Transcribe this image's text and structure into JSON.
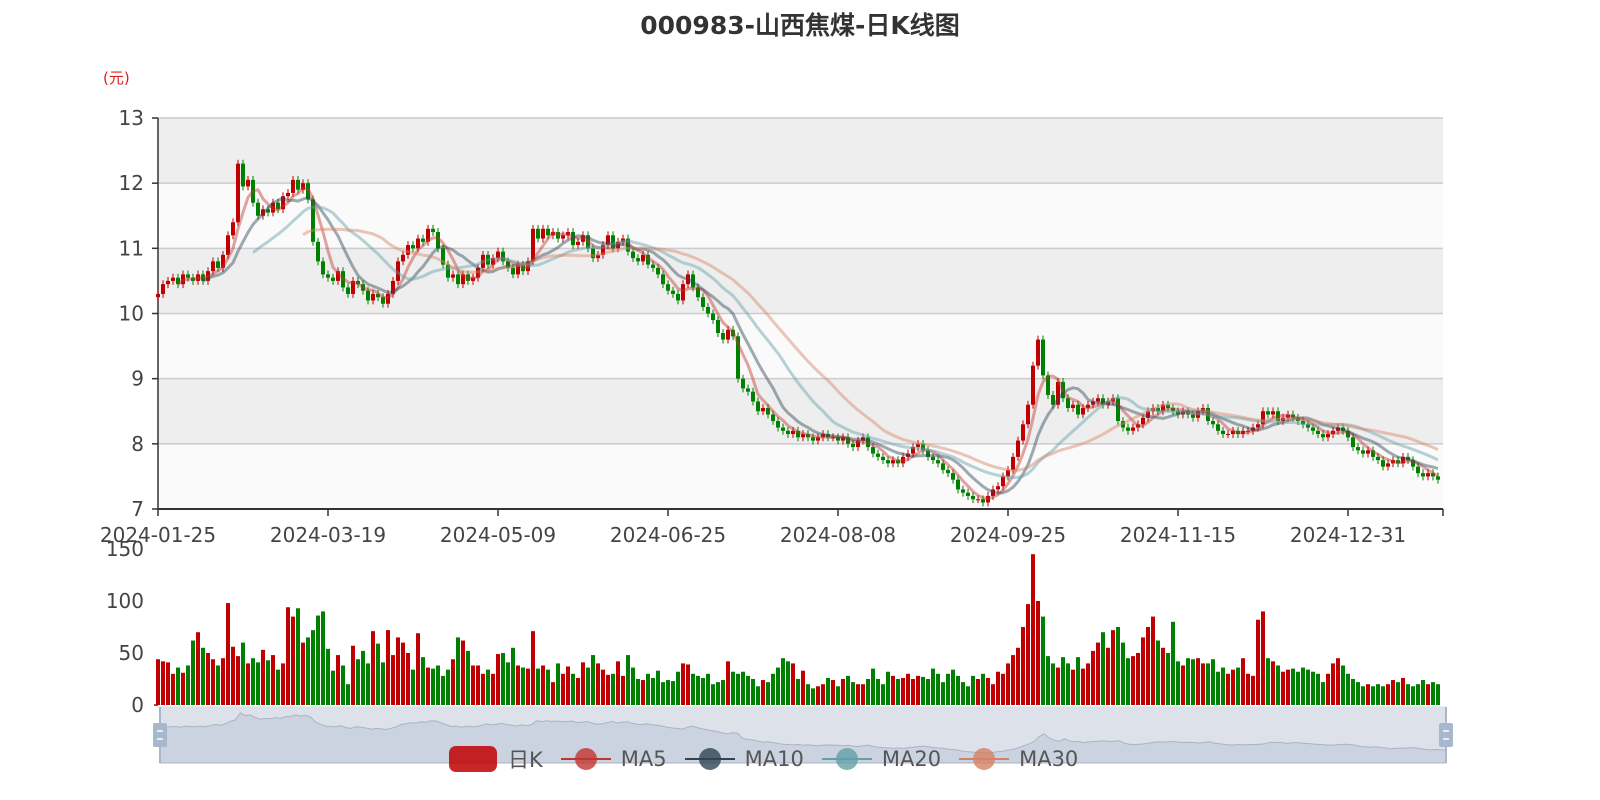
{
  "title": "000983-山西焦煤-日K线图",
  "unit_label": "(元)",
  "legend": [
    {
      "label": "日K",
      "color": "#c00000",
      "type": "candle"
    },
    {
      "label": "MA5",
      "color": "#c23531",
      "type": "line",
      "period": 5
    },
    {
      "label": "MA10",
      "color": "#2f4554",
      "type": "line",
      "period": 10
    },
    {
      "label": "MA20",
      "color": "#61a0a8",
      "type": "line",
      "period": 20
    },
    {
      "label": "MA30",
      "color": "#d48265",
      "type": "line",
      "period": 30
    }
  ],
  "colors": {
    "up": "#c00000",
    "down": "#008000",
    "band_dark": "#eeeeee",
    "band_light": "#fafafa"
  },
  "chart_data": {
    "type": "candlestick",
    "title": "000983-山西焦煤-日K线图",
    "ylabel": "(元)",
    "ylim": [
      7,
      13
    ],
    "y_ticks": [
      "7",
      "8",
      "9",
      "10",
      "11",
      "12",
      "13"
    ],
    "x_tick_labels": [
      "2024-01-25",
      "2024-03-19",
      "2024-05-09",
      "2024-06-25",
      "2024-08-08",
      "2024-09-25",
      "2024-11-15",
      "2024-12-31"
    ],
    "x_tick_every": 34,
    "close": [
      10.3,
      10.45,
      10.5,
      10.55,
      10.45,
      10.6,
      10.55,
      10.5,
      10.6,
      10.5,
      10.65,
      10.8,
      10.7,
      10.9,
      11.2,
      11.4,
      12.3,
      11.95,
      12.05,
      11.7,
      11.5,
      11.6,
      11.55,
      11.7,
      11.6,
      11.8,
      11.85,
      12.05,
      11.9,
      12.0,
      11.75,
      11.1,
      10.8,
      10.6,
      10.55,
      10.5,
      10.65,
      10.4,
      10.3,
      10.5,
      10.45,
      10.35,
      10.2,
      10.3,
      10.25,
      10.15,
      10.3,
      10.5,
      10.8,
      10.9,
      11.05,
      11.0,
      11.15,
      11.1,
      11.3,
      11.25,
      11.0,
      10.75,
      10.55,
      10.6,
      10.45,
      10.6,
      10.5,
      10.55,
      10.7,
      10.9,
      10.75,
      10.85,
      10.95,
      10.8,
      10.7,
      10.6,
      10.75,
      10.65,
      10.8,
      11.3,
      11.15,
      11.3,
      11.2,
      11.25,
      11.15,
      11.2,
      11.25,
      11.05,
      11.1,
      11.2,
      11.0,
      10.85,
      10.9,
      11.05,
      11.2,
      11.0,
      11.1,
      11.15,
      10.95,
      10.85,
      10.8,
      10.9,
      10.75,
      10.7,
      10.6,
      10.45,
      10.35,
      10.3,
      10.2,
      10.45,
      10.6,
      10.4,
      10.25,
      10.1,
      10.0,
      9.9,
      9.7,
      9.6,
      9.75,
      9.65,
      9.0,
      8.85,
      8.8,
      8.65,
      8.5,
      8.55,
      8.45,
      8.35,
      8.25,
      8.2,
      8.15,
      8.2,
      8.1,
      8.15,
      8.1,
      8.05,
      8.1,
      8.15,
      8.1,
      8.1,
      8.05,
      8.1,
      8.0,
      7.95,
      8.05,
      8.1,
      7.95,
      7.85,
      7.8,
      7.75,
      7.7,
      7.75,
      7.7,
      7.8,
      7.85,
      7.95,
      8.0,
      7.9,
      7.8,
      7.75,
      7.7,
      7.6,
      7.55,
      7.45,
      7.3,
      7.25,
      7.2,
      7.15,
      7.15,
      7.1,
      7.2,
      7.3,
      7.35,
      7.5,
      7.6,
      7.8,
      8.05,
      8.3,
      8.6,
      9.2,
      9.6,
      9.05,
      8.75,
      8.6,
      8.95,
      8.7,
      8.55,
      8.6,
      8.45,
      8.55,
      8.6,
      8.65,
      8.7,
      8.6,
      8.65,
      8.7,
      8.35,
      8.25,
      8.2,
      8.25,
      8.3,
      8.4,
      8.5,
      8.55,
      8.5,
      8.6,
      8.55,
      8.5,
      8.45,
      8.5,
      8.45,
      8.4,
      8.5,
      8.55,
      8.35,
      8.3,
      8.2,
      8.15,
      8.15,
      8.2,
      8.15,
      8.2,
      8.2,
      8.25,
      8.3,
      8.5,
      8.45,
      8.5,
      8.35,
      8.4,
      8.45,
      8.4,
      8.35,
      8.3,
      8.25,
      8.2,
      8.15,
      8.1,
      8.15,
      8.2,
      8.25,
      8.2,
      8.1,
      7.95,
      7.9,
      7.85,
      7.9,
      7.8,
      7.75,
      7.65,
      7.7,
      7.75,
      7.7,
      7.8,
      7.75,
      7.65,
      7.55,
      7.5,
      7.55,
      7.5,
      7.45
    ],
    "volume": {
      "ylim": [
        0,
        150
      ],
      "y_ticks": [
        "0",
        "50",
        "100",
        "150"
      ],
      "values": [
        44,
        42,
        41,
        30,
        36,
        31,
        38,
        62,
        70,
        55,
        50,
        44,
        38,
        45,
        98,
        56,
        47,
        60,
        40,
        45,
        41,
        53,
        43,
        48,
        34,
        40,
        94,
        85,
        93,
        60,
        65,
        72,
        86,
        90,
        54,
        33,
        48,
        38,
        20,
        57,
        44,
        52,
        40,
        71,
        59,
        41,
        72,
        48,
        65,
        60,
        50,
        34,
        69,
        46,
        36,
        35,
        38,
        28,
        34,
        44,
        65,
        62,
        52,
        38,
        38,
        30,
        34,
        30,
        49,
        50,
        41,
        55,
        38,
        36,
        35,
        71,
        35,
        38,
        34,
        22,
        40,
        30,
        37,
        30,
        26,
        41,
        36,
        48,
        40,
        34,
        29,
        30,
        42,
        28,
        48,
        36,
        25,
        24,
        30,
        26,
        33,
        22,
        24,
        23,
        32,
        40,
        39,
        30,
        28,
        26,
        30,
        20,
        22,
        24,
        42,
        32,
        30,
        32,
        28,
        25,
        18,
        24,
        22,
        30,
        36,
        45,
        42,
        40,
        25,
        33,
        20,
        16,
        18,
        20,
        26,
        24,
        18,
        25,
        28,
        22,
        20,
        20,
        25,
        35,
        25,
        20,
        32,
        28,
        25,
        26,
        30,
        25,
        28,
        27,
        25,
        35,
        30,
        22,
        30,
        34,
        28,
        22,
        18,
        28,
        25,
        30,
        26,
        20,
        32,
        30,
        40,
        48,
        55,
        75,
        97,
        145,
        100,
        85,
        47,
        40,
        36,
        46,
        40,
        34,
        46,
        35,
        40,
        52,
        60,
        70,
        55,
        72,
        75,
        60,
        45,
        47,
        50,
        65,
        75,
        85,
        62,
        55,
        50,
        80,
        42,
        38,
        45,
        44,
        45,
        40,
        40,
        44,
        32,
        36,
        30,
        34,
        36,
        45,
        30,
        28,
        82,
        90,
        45,
        42,
        38,
        32,
        34,
        35,
        32,
        36,
        34,
        32,
        30,
        22,
        30,
        40,
        45,
        38,
        30,
        25,
        22,
        18,
        20,
        18,
        20,
        18,
        20,
        24,
        22,
        26,
        20,
        18,
        20,
        24,
        20,
        22,
        20
      ]
    },
    "series": [
      {
        "name": "日K"
      },
      {
        "name": "MA5"
      },
      {
        "name": "MA10"
      },
      {
        "name": "MA20"
      },
      {
        "name": "MA30"
      }
    ],
    "grid": true,
    "legend_position": "bottom-center",
    "data_zoom_range_percent": [
      0,
      100
    ]
  }
}
